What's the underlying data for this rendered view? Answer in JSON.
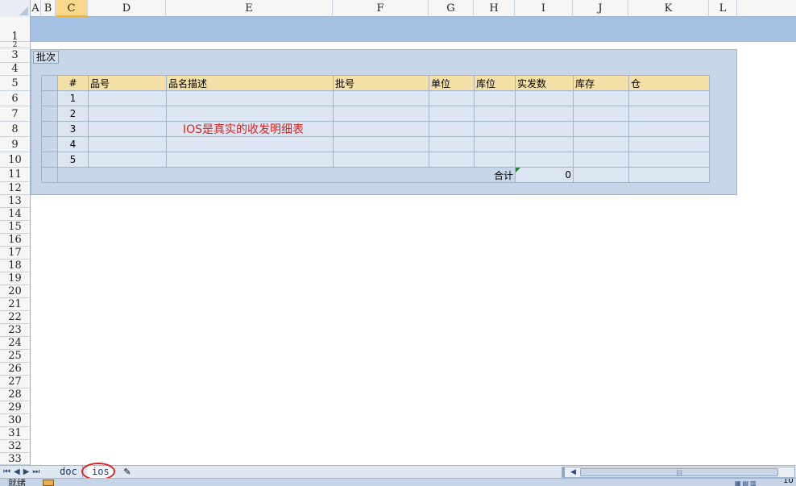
{
  "columns": [
    "A",
    "B",
    "C",
    "D",
    "E",
    "F",
    "G",
    "H",
    "I",
    "J",
    "K",
    "L"
  ],
  "active_column": "C",
  "rows": [
    "1",
    "2",
    "3",
    "4",
    "5",
    "6",
    "7",
    "8",
    "9",
    "10",
    "11",
    "12",
    "13",
    "14",
    "15",
    "16",
    "17",
    "18",
    "19",
    "20",
    "21",
    "22",
    "23",
    "24",
    "25",
    "26",
    "27",
    "28",
    "29",
    "30",
    "31",
    "32",
    "33"
  ],
  "panel": {
    "title": "批次"
  },
  "table": {
    "headers": [
      "#",
      "品号",
      "品名描述",
      "批号",
      "单位",
      "库位",
      "实发数",
      "库存",
      "仓"
    ],
    "row_numbers": [
      "1",
      "2",
      "3",
      "4",
      "5"
    ],
    "total_label": "合计",
    "total_value": "0"
  },
  "annotation": "IOS是真实的收发明细表",
  "sheet_tabs": {
    "tabs": [
      "doc",
      "ios"
    ],
    "active": "ios",
    "nav_glyphs": "⏮◀▶⏭"
  },
  "status": {
    "text": "就绪",
    "zoom": "10"
  },
  "colors": {
    "band": "#a4c1e4",
    "panel": "#c7d7e9",
    "header_fill": "#f4dfa6",
    "annotation": "#e02020",
    "highlight_circle": "#e02020"
  }
}
